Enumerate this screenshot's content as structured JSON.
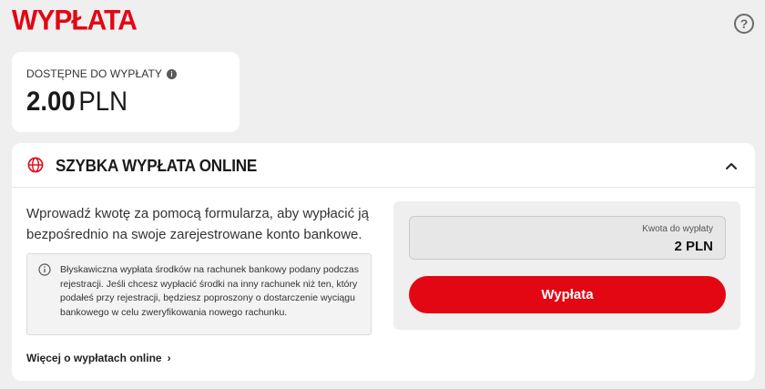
{
  "page": {
    "title": "WYPŁATA",
    "help_label": "?"
  },
  "balance": {
    "label": "DOSTĘPNE DO WYPŁATY",
    "info_symbol": "i",
    "amount": "2.00",
    "currency": "PLN"
  },
  "online_withdrawal": {
    "title": "SZYBKA WYPŁATA ONLINE",
    "expanded": true,
    "description": "Wprowadź kwotę za pomocą formularza, aby wypłacić ją bezpośrednio na swoje zarejestrowane konto bankowe.",
    "notice": "Błyskawiczna wypłata środków na rachunek bankowy podany podczas rejestracji. Jeśli chcesz wypłacić środki na inny rachunek niż ten, który podałeś przy rejestracji, będziesz poproszony o dostarczenie wyciągu bankowego w celu zweryfikowania nowego rachunku.",
    "more_link": "Więcej o wypłatach online",
    "more_chevron": "›",
    "form": {
      "amount_label": "Kwota do wypłaty",
      "amount_value": "2 PLN",
      "submit_label": "Wypłata"
    }
  },
  "icons": {
    "header": "globe-icon",
    "collapse": "chevron-up-icon",
    "notice": "info-circle-icon"
  },
  "colors": {
    "brand_red": "#e30613",
    "background": "#efefef",
    "card": "#ffffff"
  }
}
